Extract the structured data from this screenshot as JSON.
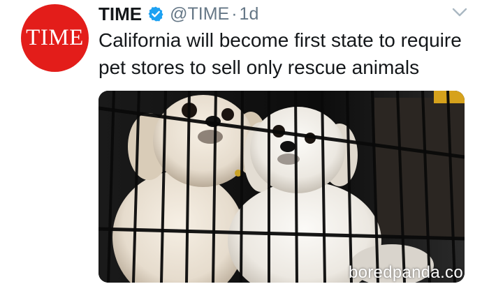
{
  "tweet": {
    "avatar_text": "TIME",
    "author_name": "TIME",
    "handle": "@TIME",
    "separator": "·",
    "timestamp": "1d",
    "text": "California will become first state to require pet stores to sell only rescue animals",
    "watermark": "boredpanda.co",
    "icons": {
      "verified": "verified-badge-icon",
      "menu": "chevron-down-icon"
    },
    "colors": {
      "brand_red": "#e31d1a",
      "verified_blue": "#1da1f2",
      "name_text": "#14171a",
      "meta_text": "#657786"
    }
  }
}
